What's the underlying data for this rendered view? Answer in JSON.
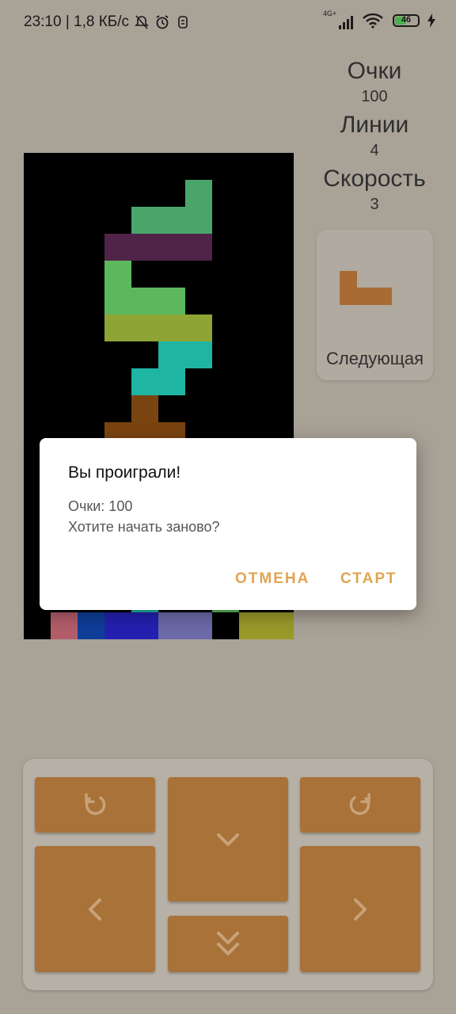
{
  "status_bar": {
    "time_speed": "23:10 | 1,8 КБ/с",
    "network": "4G+",
    "battery": "46"
  },
  "stats": {
    "score_label": "Очки",
    "score_value": "100",
    "lines_label": "Линии",
    "lines_value": "4",
    "speed_label": "Скорость",
    "speed_value": "3"
  },
  "next_piece": {
    "label": "Следующая",
    "color": "#a86b33"
  },
  "dialog": {
    "title": "Вы проиграли!",
    "score_line": "Очки: 100",
    "question": "Хотите начать заново?",
    "cancel_label": "ОТМЕНА",
    "start_label": "СТАРТ"
  },
  "colors": {
    "background": "#a9a297",
    "board": "#000000",
    "control_button": "#a87238",
    "dialog_accent": "#e0a552"
  },
  "board_blocks": [
    {
      "color": "#4aa56a",
      "name": "green-piece-top"
    },
    {
      "color": "#4f2448",
      "name": "purple-piece"
    },
    {
      "color": "#5cb85c",
      "name": "lightgreen-piece"
    },
    {
      "color": "#8ea434",
      "name": "olive-piece"
    },
    {
      "color": "#1fb5a3",
      "name": "teal-piece"
    },
    {
      "color": "#7a4410",
      "name": "brown-piece"
    },
    {
      "color": "#b35d6a",
      "name": "pink-bottom"
    },
    {
      "color": "#0f3e99",
      "name": "navy-bottom"
    },
    {
      "color": "#2420b0",
      "name": "blue-bottom"
    },
    {
      "color": "#6c6aa8",
      "name": "lavender-bottom"
    },
    {
      "color": "#9a9a2a",
      "name": "yellow-bottom"
    }
  ],
  "controls": [
    {
      "name": "rotate-left-button",
      "icon": "rotate-ccw-icon"
    },
    {
      "name": "soft-drop-button",
      "icon": "chevron-down-icon"
    },
    {
      "name": "rotate-right-button",
      "icon": "rotate-cw-icon"
    },
    {
      "name": "move-left-button",
      "icon": "chevron-left-icon"
    },
    {
      "name": "hard-drop-button",
      "icon": "double-chevron-down-icon"
    },
    {
      "name": "move-right-button",
      "icon": "chevron-right-icon"
    }
  ]
}
